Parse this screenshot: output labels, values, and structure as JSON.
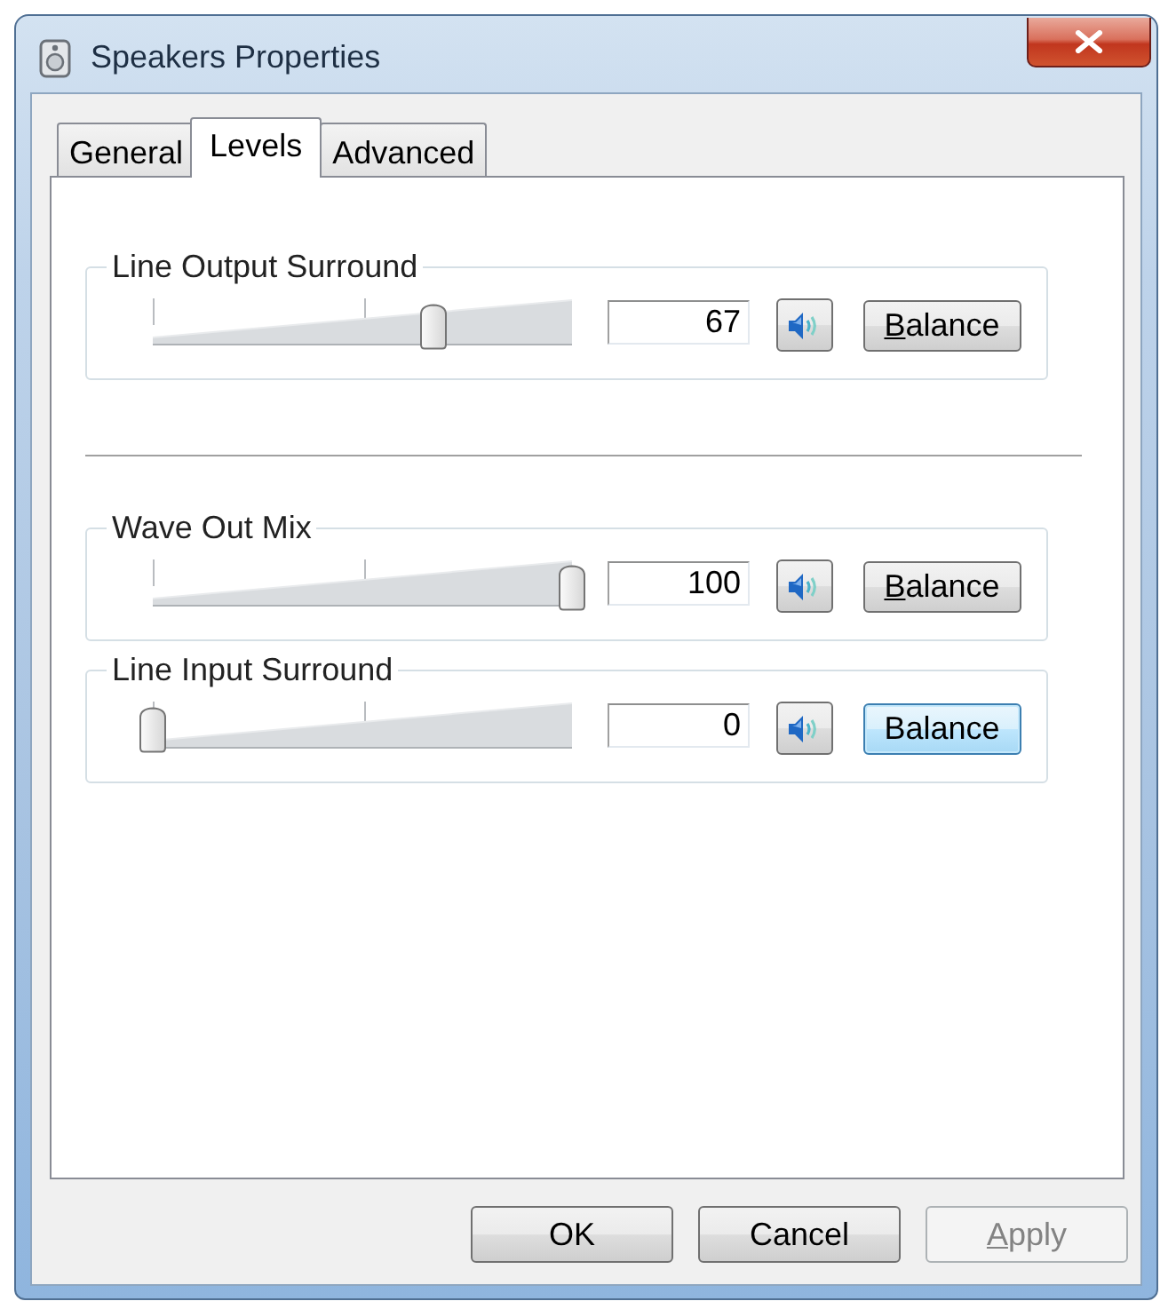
{
  "window": {
    "title": "Speakers Properties"
  },
  "tabs": [
    {
      "label": "General",
      "selected": false
    },
    {
      "label": "Levels",
      "selected": true
    },
    {
      "label": "Advanced",
      "selected": false
    }
  ],
  "channel_sections": [
    {
      "channels": [
        {
          "name": "Line Output Surround",
          "level": 0.67,
          "value": "67",
          "muted": false,
          "balance_button": {
            "label": "Balance",
            "mnemonic_underlined": true,
            "focused": false
          }
        }
      ]
    },
    {
      "channels": [
        {
          "name": "Wave Out Mix",
          "level": 1,
          "value": "100",
          "muted": false,
          "balance_button": {
            "label": "Balance",
            "mnemonic_underlined": true,
            "focused": false
          }
        },
        {
          "name": "Line Input Surround",
          "level": 0,
          "value": "0",
          "muted": false,
          "balance_button": {
            "label": "Balance",
            "mnemonic_underlined": false,
            "focused": true
          }
        }
      ]
    }
  ],
  "buttons": [
    {
      "label": "OK",
      "disabled": false,
      "mnemonic_underlined": false
    },
    {
      "label": "Cancel",
      "disabled": false,
      "mnemonic_underlined": false
    },
    {
      "label": "Apply",
      "disabled": true,
      "mnemonic_underlined": true
    }
  ]
}
